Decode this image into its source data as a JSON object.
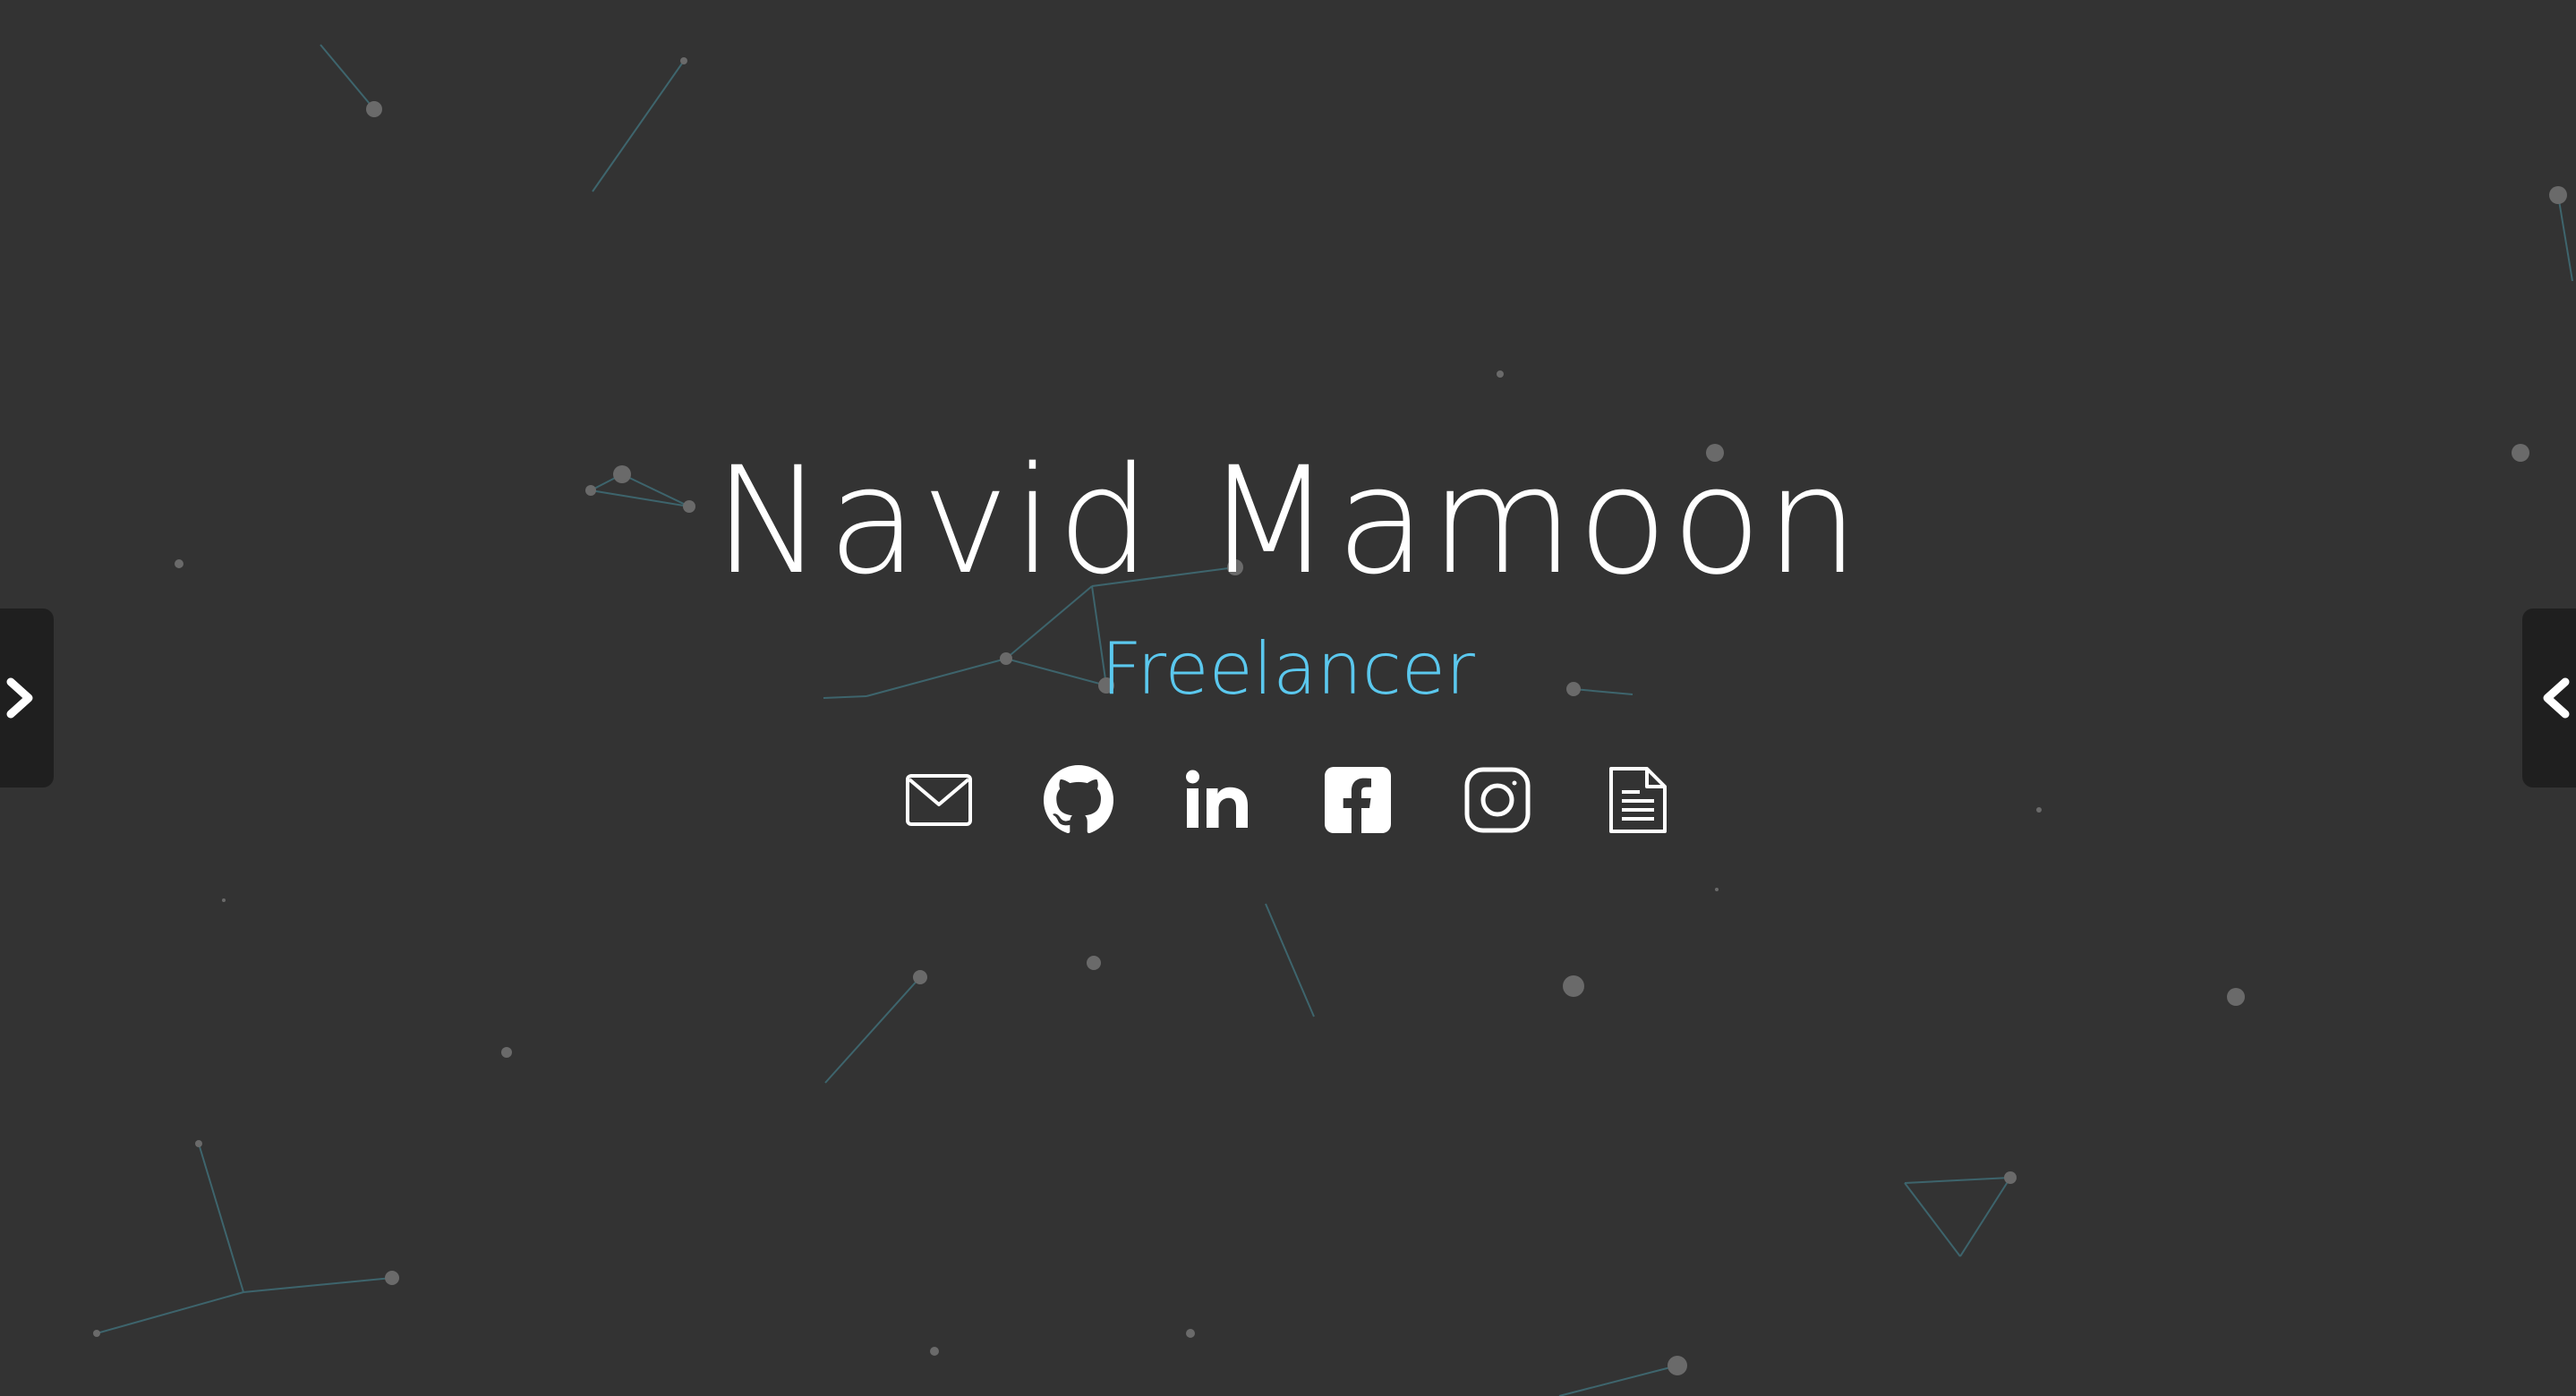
{
  "profile": {
    "name": "Navid Mamoon",
    "title": "Freelancer"
  },
  "socials": [
    {
      "name": "email-icon"
    },
    {
      "name": "github-icon"
    },
    {
      "name": "linkedin-icon"
    },
    {
      "name": "facebook-icon"
    },
    {
      "name": "instagram-icon"
    },
    {
      "name": "resume-icon"
    }
  ],
  "colors": {
    "background": "#333333",
    "accent": "#5bc8ee",
    "text": "#ffffff",
    "particle_dot": "#6a6a6a",
    "particle_line": "#3f6a73",
    "tab_background": "#1f1f1f"
  },
  "side_tabs": {
    "left_icon": "chevron-right-icon",
    "right_icon": "chevron-left-icon"
  }
}
